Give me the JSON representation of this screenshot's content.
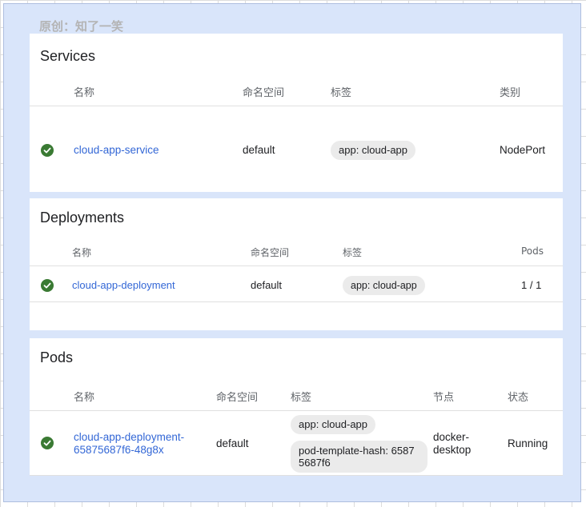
{
  "watermark": "原创：知了一笑",
  "services": {
    "title": "Services",
    "headers": {
      "name": "名称",
      "namespace": "命名空间",
      "labels": "标签",
      "type": "类别"
    },
    "rows": [
      {
        "name": "cloud-app-service",
        "namespace": "default",
        "label": "app: cloud-app",
        "type": "NodePort",
        "status": "ok"
      }
    ]
  },
  "deployments": {
    "title": "Deployments",
    "headers": {
      "name": "名称",
      "namespace": "命名空间",
      "labels": "标签",
      "pods": "Pods"
    },
    "rows": [
      {
        "name": "cloud-app-deployment",
        "namespace": "default",
        "label": "app: cloud-app",
        "pods": "1 / 1",
        "status": "ok"
      }
    ]
  },
  "pods": {
    "title": "Pods",
    "headers": {
      "name": "名称",
      "namespace": "命名空间",
      "labels": "标签",
      "node": "节点",
      "status": "状态"
    },
    "rows": [
      {
        "name_line1": "cloud-app-deployment-",
        "name_line2": "65875687f6-48g8x",
        "namespace": "default",
        "label1": "app: cloud-app",
        "label2_line1": "pod-template-hash: 6587",
        "label2_line2": "5687f6",
        "node_line1": "docker-",
        "node_line2": "desktop",
        "status": "Running"
      }
    ]
  },
  "colors": {
    "accent_link": "#3367d6",
    "status_ok": "#3a7a33",
    "frame_bg": "#d9e5fa"
  },
  "icons": {
    "status": "check-circle-icon"
  }
}
